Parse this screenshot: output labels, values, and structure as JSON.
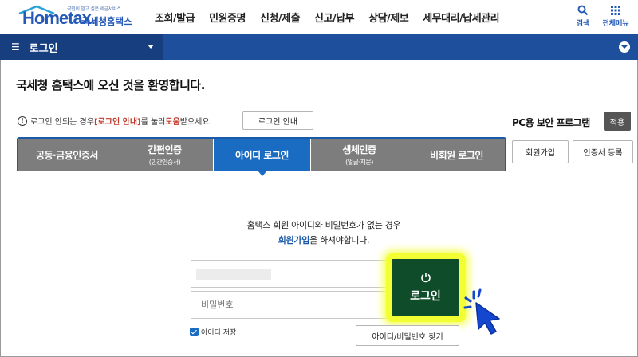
{
  "header": {
    "logo_slogan": "국민이 믿고 싶은 세금서비스",
    "logo_main": "Hometax.",
    "logo_sub": "국세청홈택스",
    "nav": [
      "조회/발급",
      "민원증명",
      "신청/제출",
      "신고/납부",
      "상담/제보",
      "세무대리/납세관리"
    ],
    "search_label": "검색",
    "menu_label": "전체메뉴"
  },
  "navbar": {
    "select_label": "로그인"
  },
  "welcome": "국세청 홈택스에 오신 것을 환영합니다.",
  "help": {
    "text_before": "로그인 안되는 경우 ",
    "highlight1": "[로그인 안내]",
    "text_mid": "를 눌러 ",
    "highlight2": "도움",
    "text_after": "받으세요.",
    "guide_button": "로그인 안내"
  },
  "security": {
    "label": "PC용 보안 프로그램",
    "apply_button": "적용"
  },
  "tabs": [
    {
      "label": "공동·금융인증서",
      "sub": ""
    },
    {
      "label": "간편인증",
      "sub": "(민간인증서)"
    },
    {
      "label": "아이디 로그인",
      "sub": ""
    },
    {
      "label": "생체인증",
      "sub": "(얼굴·지문)"
    },
    {
      "label": "비회원 로그인",
      "sub": ""
    }
  ],
  "active_tab": "아이디 로그인",
  "side_buttons": {
    "join": "회원가입",
    "cert": "인증서 등록"
  },
  "login": {
    "notice_line1": "홈택스 회원 아이디와 비밀번호가 없는 경우",
    "notice_link": "회원가입",
    "notice_line2_rest": "을 하셔야합니다.",
    "id_value": "",
    "pw_placeholder": "비밀번호",
    "login_button": "로그인",
    "save_id_label": "아이디 저장",
    "save_id_checked": true,
    "find_button": "아이디/비밀번호 찾기"
  },
  "colors": {
    "brand_blue": "#1d4f9c",
    "tab_active": "#1a6bc2",
    "tab_inactive": "#7d7d7d",
    "login_button": "#0f4c2a",
    "highlight_glow": "#f2ff33",
    "cursor": "#1446d0"
  }
}
